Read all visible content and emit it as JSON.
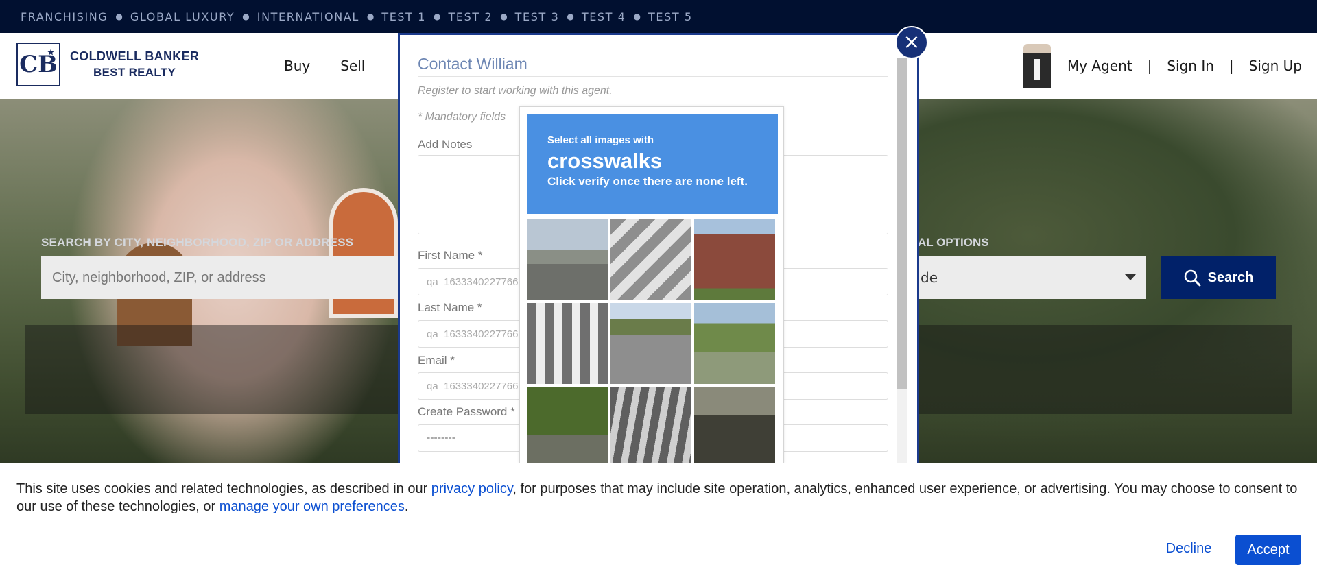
{
  "topbar": {
    "links": [
      "FRANCHISING",
      "GLOBAL LUXURY",
      "INTERNATIONAL",
      "TEST 1",
      "TEST 2",
      "TEST 3",
      "TEST 4",
      "TEST 5"
    ]
  },
  "logo": {
    "line1": "COLDWELL BANKER",
    "line2": "BEST REALTY",
    "mark": "CB"
  },
  "nav": {
    "buy": "Buy",
    "sell": "Sell"
  },
  "account": {
    "my_agent": "My Agent",
    "sep": "|",
    "sign_in": "Sign In",
    "sign_up": "Sign Up"
  },
  "search": {
    "label": "SEARCH BY CITY, NEIGHBORHOOD, ZIP OR ADDRESS",
    "placeholder": "City, neighborhood, ZIP, or address",
    "options_label": "AL OPTIONS",
    "select_value": "de",
    "button": "Search"
  },
  "modal": {
    "title": "Contact William",
    "subtitle": "Register to start working with this agent.",
    "mandatory": "* Mandatory fields",
    "notes_label": "Add Notes",
    "first_name_label": "First Name *",
    "first_name_value": "qa_1633340227766",
    "last_name_label": "Last Name *",
    "last_name_value": "qa_1633340227766",
    "email_label": "Email *",
    "email_value": "qa_1633340227766",
    "password_label": "Create Password *",
    "password_value": "••••••••",
    "close": "×"
  },
  "captcha": {
    "line1": "Select all images with",
    "target": "crosswalks",
    "line3": "Click verify once there are none left."
  },
  "cookie": {
    "text1": "This site uses cookies and related technologies, as described in our ",
    "link1": "privacy policy",
    "text2": ", for purposes that may include site operation, analytics, enhanced user experience, or advertising. You may choose to consent to our use of these technologies, or ",
    "link2": "manage your own preferences",
    "text3": ".",
    "decline": "Decline",
    "accept": "Accept"
  }
}
